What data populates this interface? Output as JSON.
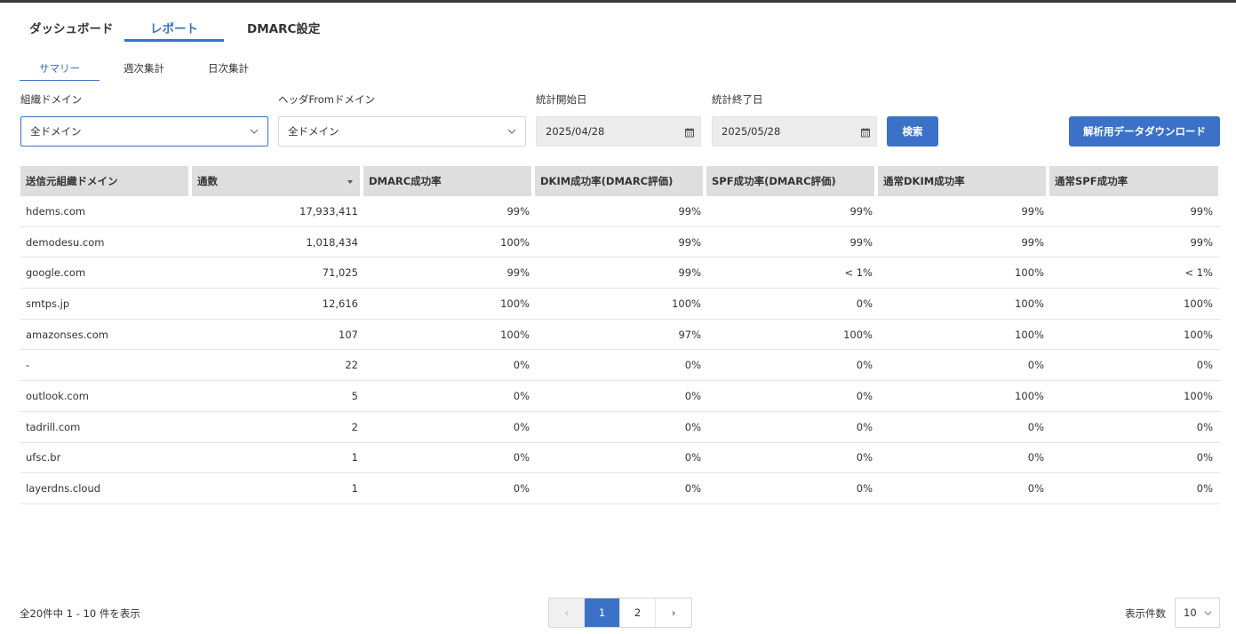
{
  "main_tabs": [
    "ダッシュボード",
    "レポート",
    "DMARC設定"
  ],
  "sub_tabs": [
    "サマリー",
    "週次集計",
    "日次集計"
  ],
  "filters": {
    "org_domain": {
      "label": "組織ドメイン",
      "value": "全ドメイン"
    },
    "from_domain": {
      "label": "ヘッダFromドメイン",
      "value": "全ドメイン"
    },
    "start_date": {
      "label": "統計開始日",
      "value": "2025/04/28"
    },
    "end_date": {
      "label": "統計終了日",
      "value": "2025/05/28"
    },
    "search_label": "検索",
    "download_label": "解析用データダウンロード"
  },
  "table": {
    "headers": [
      "送信元組織ドメイン",
      "通数",
      "DMARC成功率",
      "DKIM成功率(DMARC評価)",
      "SPF成功率(DMARC評価)",
      "通常DKIM成功率",
      "通常SPF成功率"
    ],
    "sorted_column": "通数",
    "rows": [
      [
        "hdems.com",
        "17,933,411",
        "99%",
        "99%",
        "99%",
        "99%",
        "99%"
      ],
      [
        "demodesu.com",
        "1,018,434",
        "100%",
        "99%",
        "99%",
        "99%",
        "99%"
      ],
      [
        "google.com",
        "71,025",
        "99%",
        "99%",
        "< 1%",
        "100%",
        "< 1%"
      ],
      [
        "smtps.jp",
        "12,616",
        "100%",
        "100%",
        "0%",
        "100%",
        "100%"
      ],
      [
        "amazonses.com",
        "107",
        "100%",
        "97%",
        "100%",
        "100%",
        "100%"
      ],
      [
        "-",
        "22",
        "0%",
        "0%",
        "0%",
        "0%",
        "0%"
      ],
      [
        "outlook.com",
        "5",
        "0%",
        "0%",
        "0%",
        "100%",
        "100%"
      ],
      [
        "tadrill.com",
        "2",
        "0%",
        "0%",
        "0%",
        "0%",
        "0%"
      ],
      [
        "ufsc.br",
        "1",
        "0%",
        "0%",
        "0%",
        "0%",
        "0%"
      ],
      [
        "layerdns.cloud",
        "1",
        "0%",
        "0%",
        "0%",
        "0%",
        "0%"
      ]
    ]
  },
  "pagination": {
    "summary": "全20件中 1 - 10 件を表示",
    "prev": "‹",
    "pages": [
      "1",
      "2"
    ],
    "current": "1",
    "next": "›",
    "per_page_label": "表示件数",
    "per_page_value": "10"
  },
  "icons": {
    "select": "chevron-down-icon",
    "date": "calendar-icon",
    "sort": "sort-desc-icon"
  },
  "colors": {
    "accent": "#3b72c8",
    "header_bg": "#dedede"
  }
}
